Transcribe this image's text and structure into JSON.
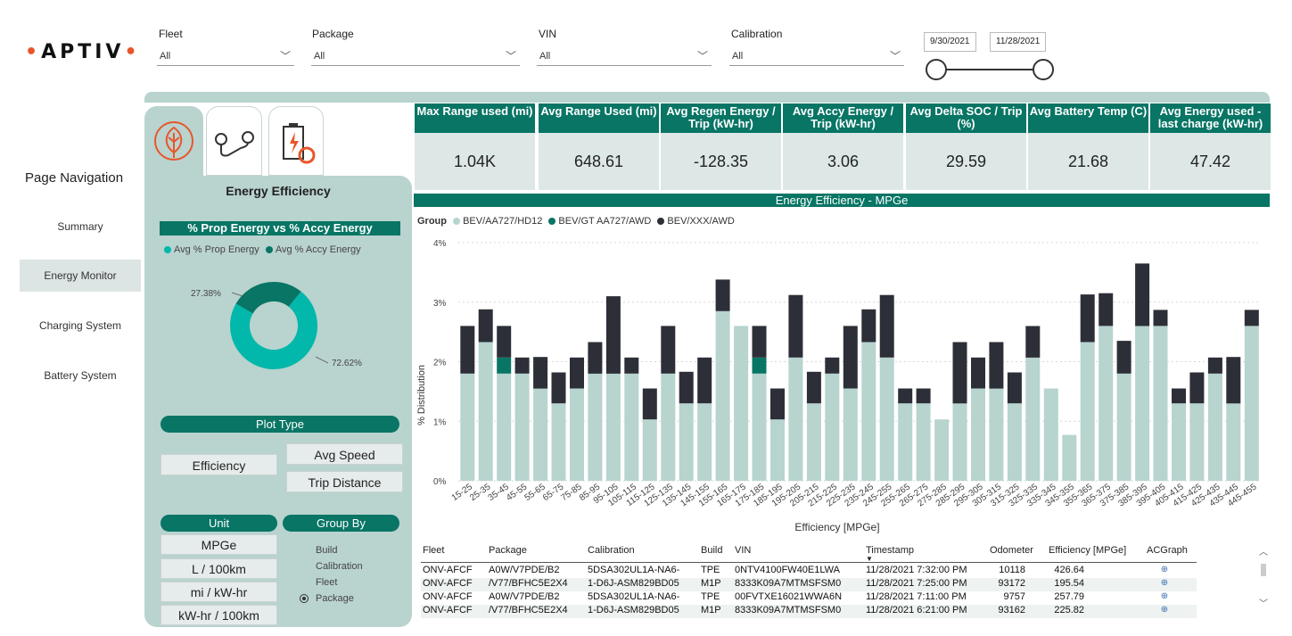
{
  "brand": {
    "name": "APTIV"
  },
  "filters": {
    "fleet": {
      "label": "Fleet",
      "value": "All"
    },
    "package": {
      "label": "Package",
      "value": "All"
    },
    "vin": {
      "label": "VIN",
      "value": "All"
    },
    "calibration": {
      "label": "Calibration",
      "value": "All"
    },
    "date_start": "9/30/2021",
    "date_end": "11/28/2021"
  },
  "nav": {
    "title": "Page Navigation",
    "items": [
      {
        "label": "Summary",
        "active": false
      },
      {
        "label": "Energy Monitor",
        "active": true
      },
      {
        "label": "Charging System",
        "active": false
      },
      {
        "label": "Battery System",
        "active": false
      }
    ]
  },
  "tabs": [
    {
      "icon": "leaf-icon",
      "active": true
    },
    {
      "icon": "route-icon",
      "active": false
    },
    {
      "icon": "battery-charge-icon",
      "active": false
    }
  ],
  "side_panel": {
    "title": "Energy Efficiency",
    "donut_title": "% Prop Energy vs % Accy Energy",
    "legend": [
      {
        "name": "Avg % Prop Energy",
        "color": "#01b8aa"
      },
      {
        "name": "Avg % Accy Energy",
        "color": "#087565"
      }
    ],
    "slices": [
      {
        "label": "72.62%",
        "value": 72.62,
        "color": "#01b8aa"
      },
      {
        "label": "27.38%",
        "value": 27.38,
        "color": "#087565"
      }
    ],
    "plot_type": {
      "label": "Plot Type",
      "options": [
        "Efficiency",
        "Avg Speed",
        "Trip Distance"
      ]
    },
    "unit": {
      "label": "Unit",
      "options": [
        "MPGe",
        "L / 100km",
        "mi / kW-hr",
        "kW-hr / 100km"
      ]
    },
    "group_by": {
      "label": "Group By",
      "options": [
        "Build",
        "Calibration",
        "Fleet",
        "Package"
      ],
      "selected": "Package"
    }
  },
  "kpis": [
    {
      "label": "Max Range used (mi)",
      "value": "1.04K"
    },
    {
      "label": "Avg Range Used (mi)",
      "value": "648.61"
    },
    {
      "label": "Avg Regen Energy / Trip (kW-hr)",
      "value": "-128.35"
    },
    {
      "label": "Avg Accy Energy / Trip (kW-hr)",
      "value": "3.06"
    },
    {
      "label": "Avg Delta SOC / Trip (%)",
      "value": "29.59"
    },
    {
      "label": "Avg Battery Temp (C)",
      "value": "21.68"
    },
    {
      "label": "Avg Energy used - last charge (kW-hr)",
      "value": "47.42"
    }
  ],
  "chart_data": {
    "type": "bar",
    "title": "Energy Efficiency - MPGe",
    "legend_title": "Group",
    "xlabel": "Efficiency [MPGe]",
    "ylabel": "% Distribution",
    "ylim": [
      0,
      4
    ],
    "yticks": [
      "0%",
      "1%",
      "2%",
      "3%",
      "4%"
    ],
    "stacked": true,
    "categories": [
      "15-25",
      "25-35",
      "35-45",
      "45-55",
      "55-65",
      "65-75",
      "75-85",
      "85-95",
      "95-105",
      "105-115",
      "115-125",
      "125-135",
      "135-145",
      "145-155",
      "155-165",
      "165-175",
      "175-185",
      "185-195",
      "195-205",
      "205-215",
      "215-225",
      "225-235",
      "235-245",
      "245-255",
      "255-265",
      "265-275",
      "275-285",
      "285-295",
      "295-305",
      "305-315",
      "315-325",
      "325-335",
      "335-345",
      "345-355",
      "355-365",
      "365-375",
      "375-385",
      "385-395",
      "395-405",
      "405-415",
      "415-425",
      "425-435",
      "435-445",
      "445-455"
    ],
    "series": [
      {
        "name": "BEV/AA727/HD12",
        "color": "#b7d4cf",
        "values": [
          1.8,
          2.33,
          1.8,
          1.8,
          1.55,
          1.3,
          1.55,
          1.8,
          1.8,
          1.8,
          1.03,
          1.8,
          1.3,
          1.3,
          2.85,
          2.6,
          1.8,
          1.03,
          2.07,
          1.3,
          1.8,
          1.55,
          2.33,
          2.07,
          1.3,
          1.3,
          1.03,
          1.3,
          1.55,
          1.55,
          1.3,
          2.07,
          1.55,
          0.77,
          2.33,
          2.6,
          1.8,
          2.6,
          2.6,
          1.3,
          1.3,
          1.8,
          1.3,
          2.6
        ]
      },
      {
        "name": "BEV/GT AA727/AWD",
        "color": "#087565",
        "values": [
          0,
          0,
          0.27,
          0,
          0,
          0,
          0,
          0,
          0,
          0,
          0,
          0,
          0,
          0,
          0,
          0,
          0.27,
          0,
          0,
          0,
          0,
          0,
          0,
          0,
          0,
          0,
          0,
          0,
          0,
          0,
          0,
          0,
          0,
          0,
          0,
          0,
          0,
          0,
          0,
          0,
          0,
          0,
          0,
          0
        ]
      },
      {
        "name": "BEV/XXX/AWD",
        "color": "#2d2f38",
        "values": [
          0.8,
          0.55,
          0.53,
          0.27,
          0.53,
          0.52,
          0.52,
          0.53,
          1.3,
          0.27,
          0.52,
          0.8,
          0.53,
          0.77,
          0.53,
          0,
          0.53,
          0.52,
          1.05,
          0.53,
          0.27,
          1.05,
          0.55,
          1.05,
          0.25,
          0.25,
          0,
          1.03,
          0.52,
          0.78,
          0.52,
          0.53,
          0,
          0,
          0.8,
          0.55,
          0.55,
          1.05,
          0.27,
          0.25,
          0.52,
          0.27,
          0.78,
          0.27
        ]
      }
    ]
  },
  "table": {
    "columns": [
      "Fleet",
      "Package",
      "Calibration",
      "Build",
      "VIN",
      "Timestamp",
      "Odometer",
      "Efficiency [MPGe]",
      "ACGraph"
    ],
    "rows": [
      [
        "ONV-AFCF",
        "A0W/V7PDE/B2",
        "5DSA302UL1A-NA6-",
        "TPE",
        "0NTV4100FW40E1LWA",
        "11/28/2021 7:32:00 PM",
        "10118",
        "426.64",
        "⊕"
      ],
      [
        "ONV-AFCF",
        "/V77/BFHC5E2X4",
        "1-D6J-ASM829BD05",
        "M1P",
        "8333K09A7MTMSFSM0",
        "11/28/2021 7:25:00 PM",
        "93172",
        "195.54",
        "⊕"
      ],
      [
        "ONV-AFCF",
        "A0W/V7PDE/B2",
        "5DSA302UL1A-NA6-",
        "TPE",
        "00FVTXE16021WWA6N",
        "11/28/2021 7:11:00 PM",
        "9757",
        "257.79",
        "⊕"
      ],
      [
        "ONV-AFCF",
        "/V77/BFHC5E2X4",
        "1-D6J-ASM829BD05",
        "M1P",
        "8333K09A7MTMSFSM0",
        "11/28/2021 6:21:00 PM",
        "93162",
        "225.82",
        "⊕"
      ]
    ]
  }
}
